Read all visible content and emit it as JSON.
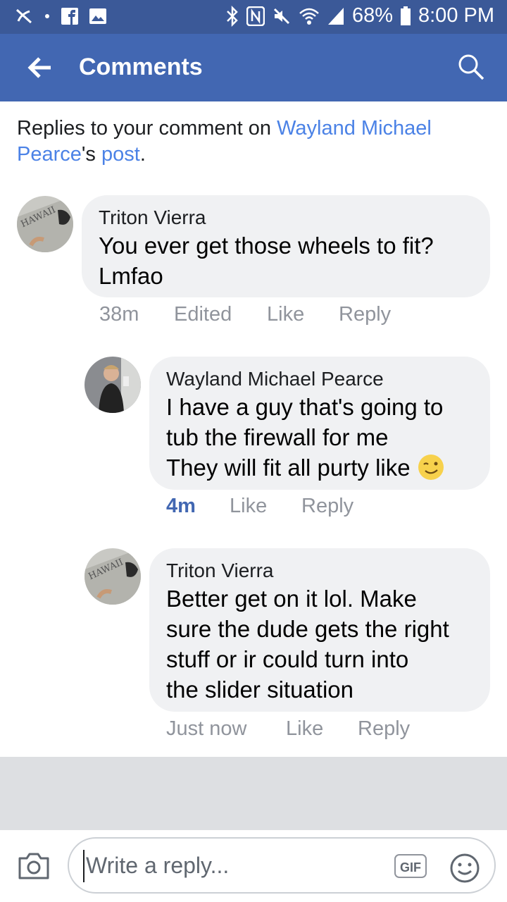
{
  "status_bar": {
    "battery": "68%",
    "time": "8:00 PM"
  },
  "app_bar": {
    "title": "Comments"
  },
  "header": {
    "prefix": "Replies to your comment on ",
    "author_link": "Wayland Michael Pearce",
    "possessive": "'s ",
    "post_link": "post",
    "suffix": "."
  },
  "comments": [
    {
      "author": "Triton Vierra",
      "lines": [
        "You ever get those wheels to fit?",
        "Lmfao"
      ],
      "time": "38m",
      "edited": "Edited",
      "like": "Like",
      "reply": "Reply",
      "avatar": "hawaii-avatar"
    },
    {
      "author": "Wayland Michael Pearce",
      "lines": [
        "I have a guy that's going to",
        "tub the firewall for me",
        "They will fit all purty like"
      ],
      "emoji": "wink-emoji",
      "time": "4m",
      "like": "Like",
      "reply": "Reply",
      "avatar": "selfie-avatar"
    },
    {
      "author": "Triton Vierra",
      "lines": [
        "Better get on it lol. Make",
        "sure the dude gets the right",
        "stuff or ir could turn into",
        "the slider situation"
      ],
      "time": "Just now",
      "like": "Like",
      "reply": "Reply",
      "avatar": "hawaii-avatar"
    }
  ],
  "composer": {
    "placeholder": "Write a reply...",
    "gif_label": "GIF"
  },
  "colors": {
    "brand": "#4267b2",
    "statusbar": "#3b5998",
    "link": "#4b82e6",
    "bubble": "#f0f1f3",
    "meta": "#90949c"
  }
}
